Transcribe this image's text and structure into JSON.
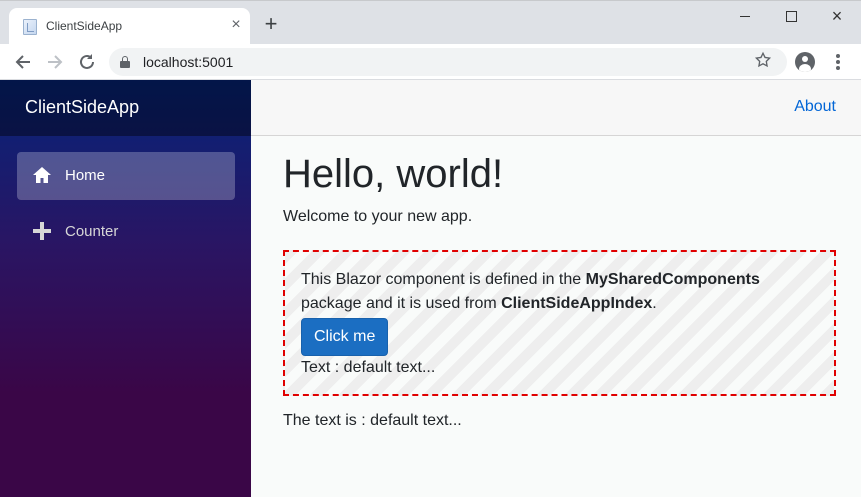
{
  "browser": {
    "tab_title": "ClientSideApp",
    "new_tab_symbol": "+",
    "close_symbol": "×",
    "url": "localhost:5001"
  },
  "app": {
    "brand": "ClientSideApp",
    "nav": [
      {
        "label": "Home",
        "icon": "home-icon",
        "active": true
      },
      {
        "label": "Counter",
        "icon": "plus-icon",
        "active": false
      }
    ],
    "top_link": "About",
    "heading": "Hello, world!",
    "welcome": "Welcome to your new app.",
    "component": {
      "text_before": "This Blazor component is defined in the ",
      "package_name": "MySharedComponents",
      "text_middle": " package and it is used from ",
      "used_from": "ClientSideAppIndex",
      "text_end": ".",
      "button_label": "Click me",
      "text_line": "Text : default text..."
    },
    "result_text": "The text is : default text..."
  },
  "colors": {
    "accent": "#1b6ec2",
    "link": "#0366d6",
    "dashed_border": "#e00000",
    "sidebar_top": "#05247a",
    "sidebar_bottom": "#3a0647"
  }
}
